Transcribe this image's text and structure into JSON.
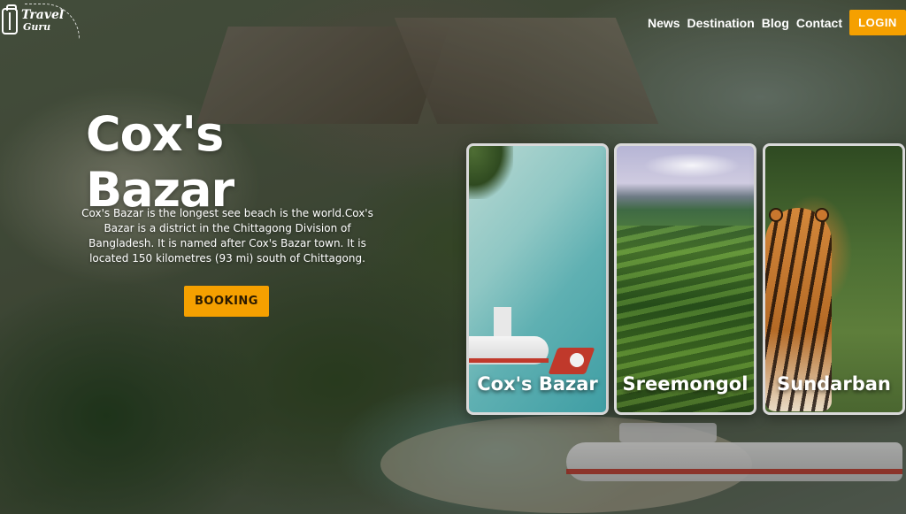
{
  "brand": {
    "line1": "Travel",
    "line2": "Guru"
  },
  "nav": {
    "items": [
      "News",
      "Destination",
      "Blog",
      "Contact"
    ],
    "login_label": "LOGIN"
  },
  "hero": {
    "title": "Cox's Bazar",
    "description": "Cox's Bazar is the longest see beach is the world.Cox's Bazar is a district in the Chittagong Division of Bangladesh. It is named after Cox's Bazar town. It is located 150 kilometres (93 mi) south of Chittagong.",
    "booking_label": "BOOKING"
  },
  "cards": [
    {
      "name": "Cox's Bazar",
      "icon": "beach-seaplane-image"
    },
    {
      "name": "Sreemongol",
      "icon": "tea-garden-image"
    },
    {
      "name": "Sundarban",
      "icon": "tiger-image"
    }
  ],
  "colors": {
    "accent": "#f5a000",
    "card_border": "#d9d9d9"
  }
}
